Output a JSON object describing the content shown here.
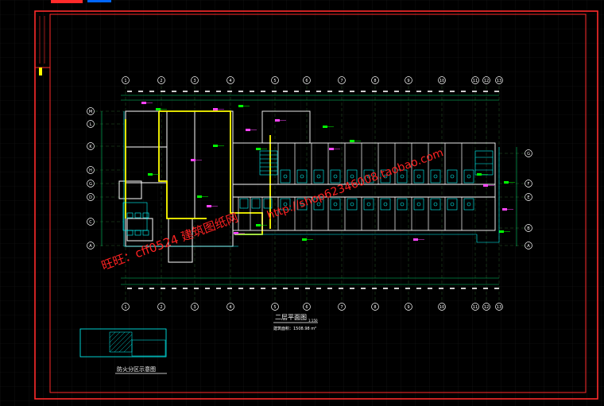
{
  "drawing": {
    "column_axes": [
      "1",
      "2",
      "3",
      "4",
      "5",
      "6",
      "7",
      "8",
      "9",
      "10",
      "11",
      "12",
      "13"
    ],
    "row_axes_left": [
      "M",
      "L",
      "K",
      "H",
      "G",
      "D",
      "C",
      "A"
    ],
    "row_axes_right": [
      "G",
      "F",
      "E",
      "B",
      "A"
    ],
    "plan_title": "二层平面图",
    "plan_scale": "1:150",
    "area_label": "建筑面积：1508.98 m²",
    "inset_title": "防火分区示意图",
    "watermark_left": "旺旺：cff0524  建筑图纸网",
    "watermark_right": "http://shop62346008.taobao.com"
  },
  "colors": {
    "background": "#000000",
    "frame": "#ff2a2a",
    "walls": "#ffffff",
    "firewall": "#ffff00",
    "cyan": "#00ffff",
    "green": "#00ff00",
    "magenta": "#ff44ff",
    "watermark": "#ff2222"
  }
}
